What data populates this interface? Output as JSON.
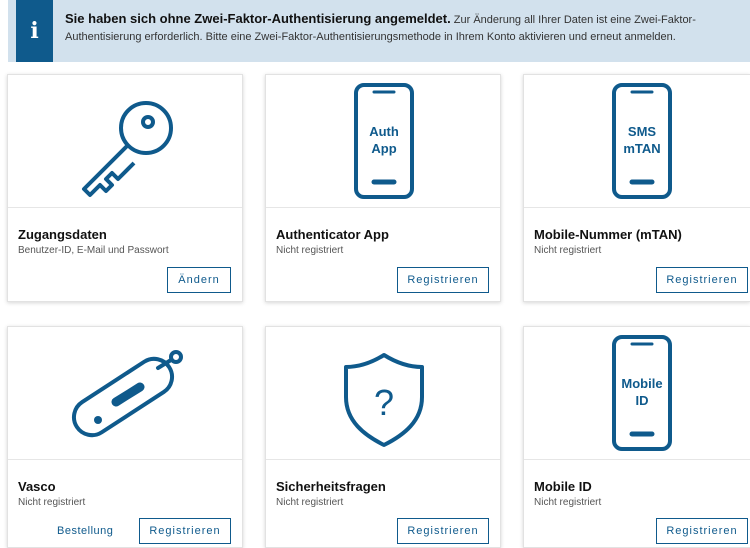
{
  "banner": {
    "icon": "info-icon",
    "headline": "Sie haben sich ohne Zwei-Faktor-Authentisierung angemeldet.",
    "message": " Zur Änderung all Ihrer Daten ist eine Zwei-Faktor-Authentisierung erforderlich. Bitte eine Zwei-Faktor-Authentisierungsmethode in Ihrem Konto aktivieren und erneut anmelden."
  },
  "cards": [
    {
      "icon": "key-icon",
      "title": "Zugangsdaten",
      "subtitle": "Benutzer-ID, E-Mail und Passwort",
      "button": "Ändern"
    },
    {
      "icon": "phone-icon",
      "phone_label": [
        "Auth",
        "App"
      ],
      "title": "Authenticator App",
      "subtitle": "Nicht registriert",
      "button": "Registrieren"
    },
    {
      "icon": "phone-icon",
      "phone_label": [
        "SMS",
        "mTAN"
      ],
      "title": "Mobile-Nummer (mTAN)",
      "subtitle": "Nicht registriert",
      "button": "Registrieren"
    },
    {
      "icon": "token-device-icon",
      "title": "Vasco",
      "subtitle": "Nicht registriert",
      "link": "Bestellung",
      "button": "Registrieren"
    },
    {
      "icon": "shield-question-icon",
      "title": "Sicherheitsfragen",
      "subtitle": "Nicht registriert",
      "button": "Registrieren"
    },
    {
      "icon": "phone-icon",
      "phone_label": [
        "Mobile",
        "ID"
      ],
      "title": "Mobile ID",
      "subtitle": "Nicht registriert",
      "button": "Registrieren"
    }
  ],
  "colors": {
    "accent": "#0f5a8c",
    "banner_bg": "#d2e1ed"
  }
}
